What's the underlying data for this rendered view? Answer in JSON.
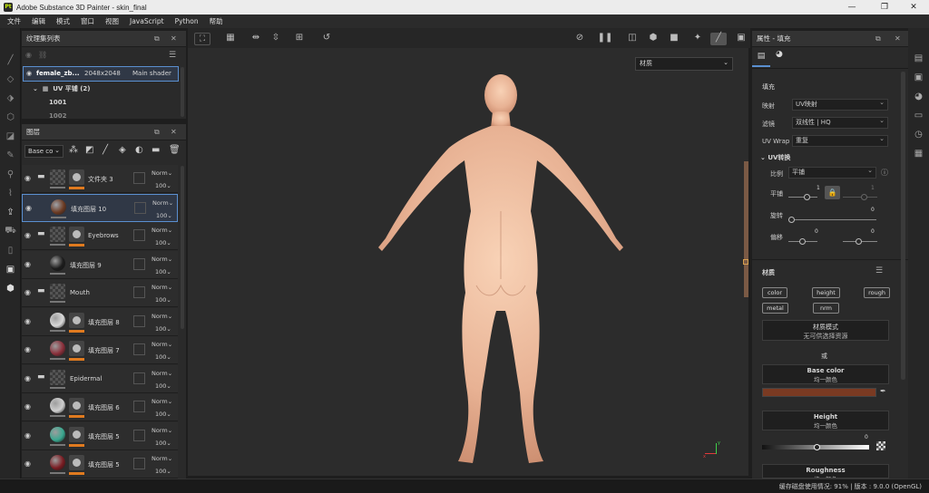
{
  "app": {
    "title": "Adobe Substance 3D Painter - skin_final",
    "logo_text": "Pt"
  },
  "menu": [
    "文件",
    "编辑",
    "模式",
    "窗口",
    "视图",
    "JavaScript",
    "Python",
    "帮助"
  ],
  "texture_set": {
    "title": "纹理集列表",
    "item": {
      "name": "female_zb...",
      "res": "2048x2048",
      "shader": "Main shader"
    },
    "uv_label": "UV 平铺 (2)",
    "uv_items": [
      "1001",
      "1002"
    ]
  },
  "layers": {
    "title": "图层",
    "channel_select": "Base co",
    "rows": [
      {
        "name": "文件夹 3",
        "blend": "Norm",
        "opacity": "100",
        "folder": true,
        "thumb": "checker",
        "mask": true
      },
      {
        "name": "填充图层 10",
        "blend": "Norm",
        "opacity": "100",
        "folder": false,
        "thumb": "#6b3a22",
        "mask": false,
        "selected": true
      },
      {
        "name": "Eyebrows",
        "blend": "Norm",
        "opacity": "100",
        "folder": true,
        "thumb": "checker",
        "mask": true
      },
      {
        "name": "填充图层 9",
        "blend": "Norm",
        "opacity": "100",
        "folder": false,
        "thumb": "#1c1c1c",
        "mask": false
      },
      {
        "name": "Mouth",
        "blend": "Norm",
        "opacity": "100",
        "folder": true,
        "thumb": "checker",
        "mask": false
      },
      {
        "name": "填充图层 8",
        "blend": "Norm",
        "opacity": "100",
        "folder": false,
        "thumb": "#d8d8d8",
        "mask": true
      },
      {
        "name": "填充图层 7",
        "blend": "Norm",
        "opacity": "100",
        "folder": false,
        "thumb": "#8a2f3a",
        "mask": true
      },
      {
        "name": "Epidermal",
        "blend": "Norm",
        "opacity": "100",
        "folder": true,
        "thumb": "checker",
        "mask": false
      },
      {
        "name": "填充图层 6",
        "blend": "Norm",
        "opacity": "100",
        "folder": false,
        "thumb": "#d0d0d0",
        "mask": true
      },
      {
        "name": "填充图层 5",
        "blend": "Norm",
        "opacity": "100",
        "folder": false,
        "thumb": "#3aa890",
        "mask": true
      },
      {
        "name": "填充图层 5",
        "blend": "Norm",
        "opacity": "100",
        "folder": false,
        "thumb": "#7a1c22",
        "mask": true
      }
    ]
  },
  "viewport": {
    "material_dropdown": "材质",
    "axis_y": "y",
    "axis_x": "x"
  },
  "properties": {
    "title": "属性 - 填充",
    "fill_section": "填充",
    "mapping_label": "映射",
    "mapping_value": "UV映射",
    "filter_label": "滤镜",
    "filter_value": "双线性 | HQ",
    "wrap_label": "UV Wrap",
    "wrap_value": "重复",
    "uv_transform": "UV转换",
    "scale_label": "比例",
    "scale_value": "平铺",
    "tile_label": "平铺",
    "tile_value": "1",
    "tile_value2": "1",
    "rotate_label": "旋转",
    "rotate_value": "0",
    "offset_label": "偏移",
    "offset_value1": "0",
    "offset_value2": "0",
    "material_section": "材质",
    "chips": [
      "color",
      "height",
      "rough",
      "metal",
      "nrm"
    ],
    "material_mode": "材质模式",
    "material_mode_sub": "无可供选择资源",
    "or_text": "或",
    "base_color": "Base color",
    "uniform_color": "均一颜色",
    "base_color_hex": "#7a3a22",
    "height": "Height",
    "height_value": "0",
    "roughness": "Roughness"
  },
  "status": "缓存磁盘使用情况:  91%  |  版本 : 9.0.0 (OpenGL)"
}
